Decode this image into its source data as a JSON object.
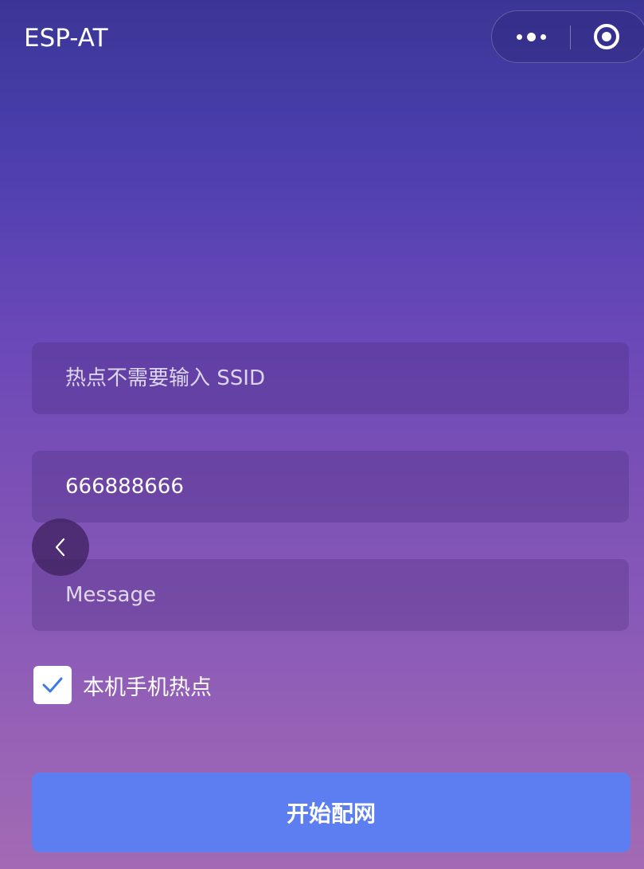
{
  "header": {
    "title": "ESP-AT",
    "menu_icon": "more-dots-icon",
    "close_icon": "target-circle-icon"
  },
  "form": {
    "ssid_placeholder": "热点不需要输入 SSID",
    "ssid_value": "",
    "password_value": "666888666",
    "message_placeholder": "Message",
    "message_value": "",
    "hotspot_checkbox": {
      "label": "本机手机热点",
      "checked": true
    },
    "submit_label": "开始配网"
  },
  "nav": {
    "back_icon": "chevron-left-icon"
  },
  "colors": {
    "button": "#5c7ef0",
    "check": "#3b7be0"
  }
}
